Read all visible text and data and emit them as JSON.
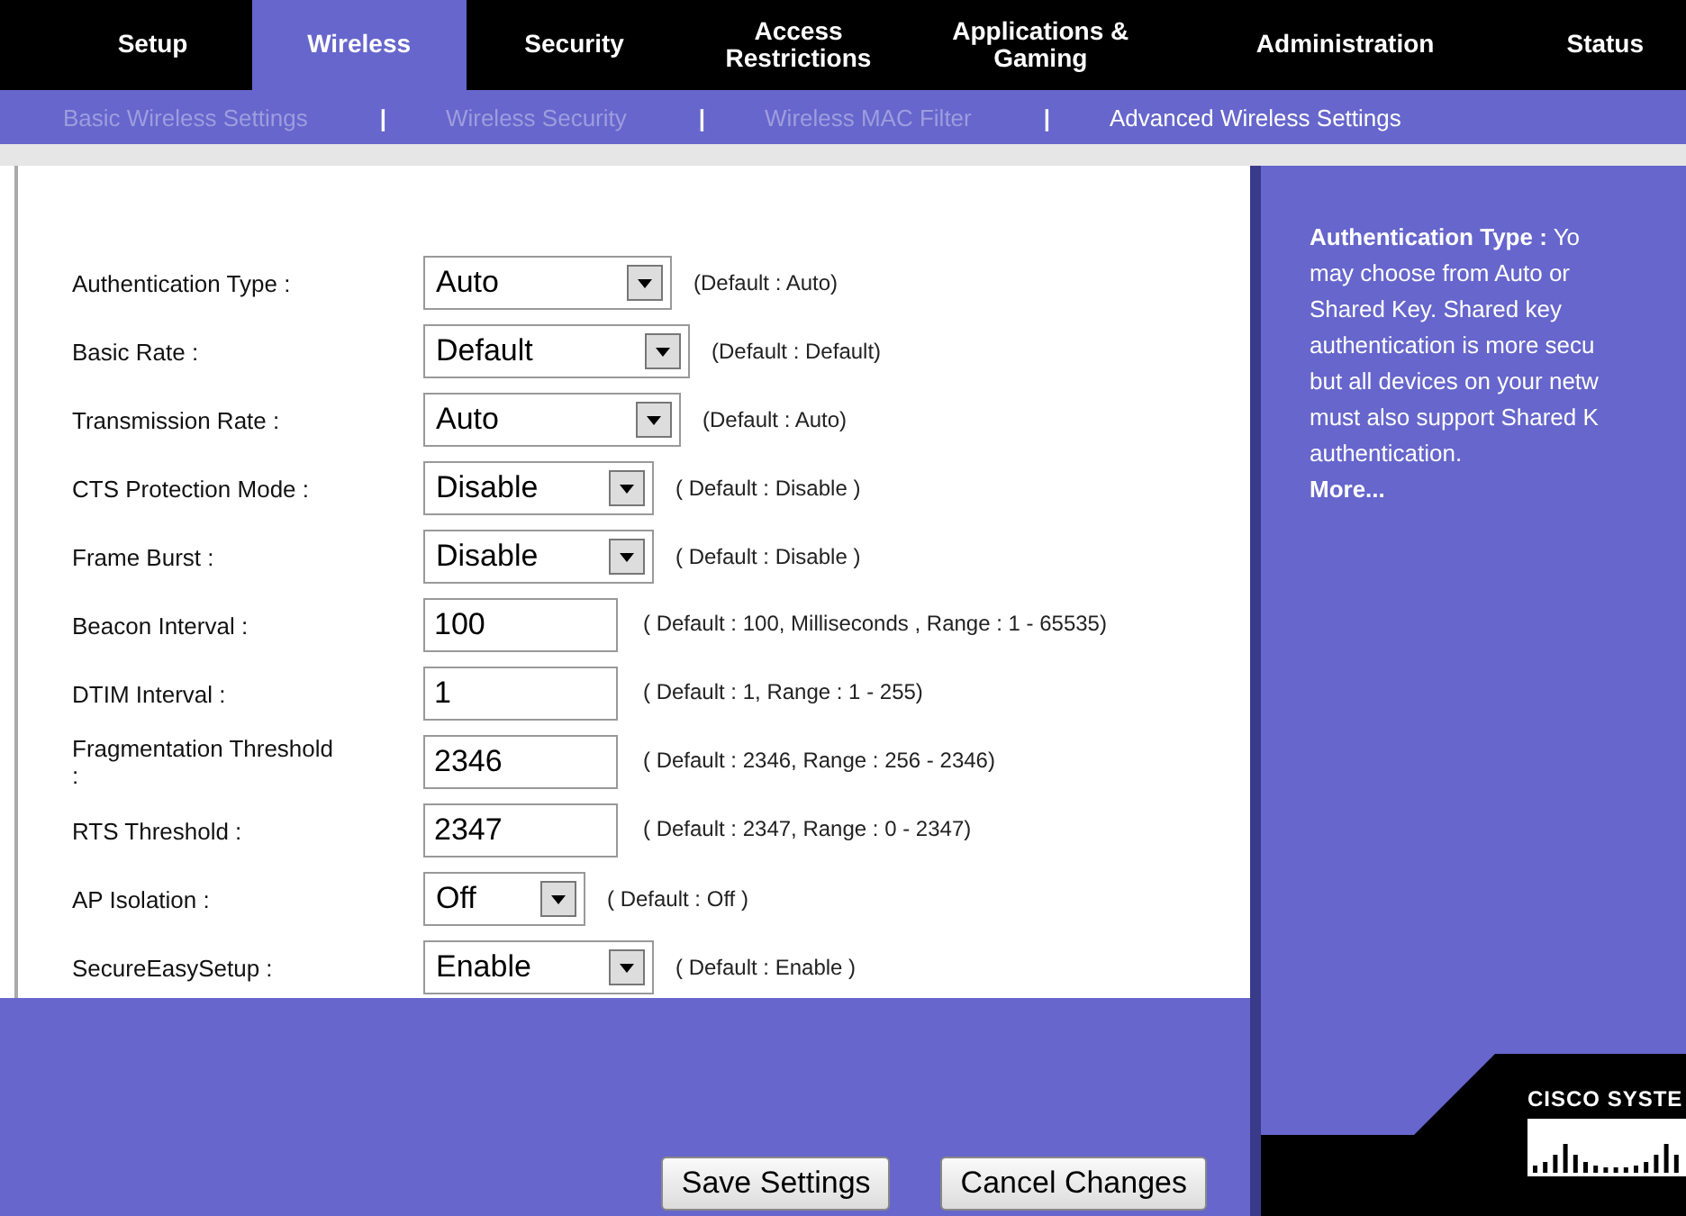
{
  "tabs": [
    {
      "label": "Setup",
      "selected": false
    },
    {
      "label": "Wireless",
      "selected": true
    },
    {
      "label": "Security",
      "selected": false
    },
    {
      "label": "Access Restrictions",
      "selected": false
    },
    {
      "label": "Applications & Gaming",
      "selected": false
    },
    {
      "label": "Administration",
      "selected": false
    },
    {
      "label": "Status",
      "selected": false
    }
  ],
  "subnav": {
    "separator": "|",
    "items": [
      {
        "label": "Basic Wireless Settings",
        "selected": false
      },
      {
        "label": "Wireless Security",
        "selected": false
      },
      {
        "label": "Wireless MAC Filter",
        "selected": false
      },
      {
        "label": "Advanced Wireless Settings",
        "selected": true
      }
    ]
  },
  "fields": [
    {
      "kind": "select",
      "label": "Authentication Type :",
      "value": "Auto",
      "note": "(Default : Auto)"
    },
    {
      "kind": "select",
      "label": "Basic Rate :",
      "value": "Default",
      "note": "(Default : Default)"
    },
    {
      "kind": "select",
      "label": "Transmission Rate :",
      "value": "Auto",
      "note": "(Default : Auto)"
    },
    {
      "kind": "select",
      "label": "CTS Protection Mode :",
      "value": "Disable",
      "note": "( Default : Disable )"
    },
    {
      "kind": "select",
      "label": "Frame Burst :",
      "value": "Disable",
      "note": "( Default : Disable )"
    },
    {
      "kind": "input",
      "label": "Beacon Interval :",
      "value": "100",
      "note": "( Default : 100, Milliseconds , Range : 1 - 65535)"
    },
    {
      "kind": "input",
      "label": "DTIM Interval :",
      "value": "1",
      "note": "( Default : 1, Range : 1 - 255)"
    },
    {
      "kind": "input",
      "label": "Fragmentation Threshold :",
      "value": "2346",
      "note": "( Default : 2346, Range : 256 - 2346)"
    },
    {
      "kind": "input",
      "label": "RTS Threshold :",
      "value": "2347",
      "note": "( Default : 2347, Range : 0 - 2347)"
    },
    {
      "kind": "select",
      "label": "AP Isolation :",
      "value": "Off",
      "note": "( Default : Off )"
    },
    {
      "kind": "select",
      "label": "SecureEasySetup :",
      "value": "Enable",
      "note": "( Default : Enable )"
    }
  ],
  "buttons": [
    "Save Settings",
    "Cancel Changes"
  ],
  "help": {
    "lines": [
      "**Authentication Type :** Yo",
      "may choose from Auto or",
      "Shared Key. Shared key",
      "authentication is more secu",
      "but all devices on your netw",
      "must also support Shared K",
      "authentication."
    ],
    "link": "More..."
  },
  "logo": {
    "text": "CISCO SYSTE"
  }
}
